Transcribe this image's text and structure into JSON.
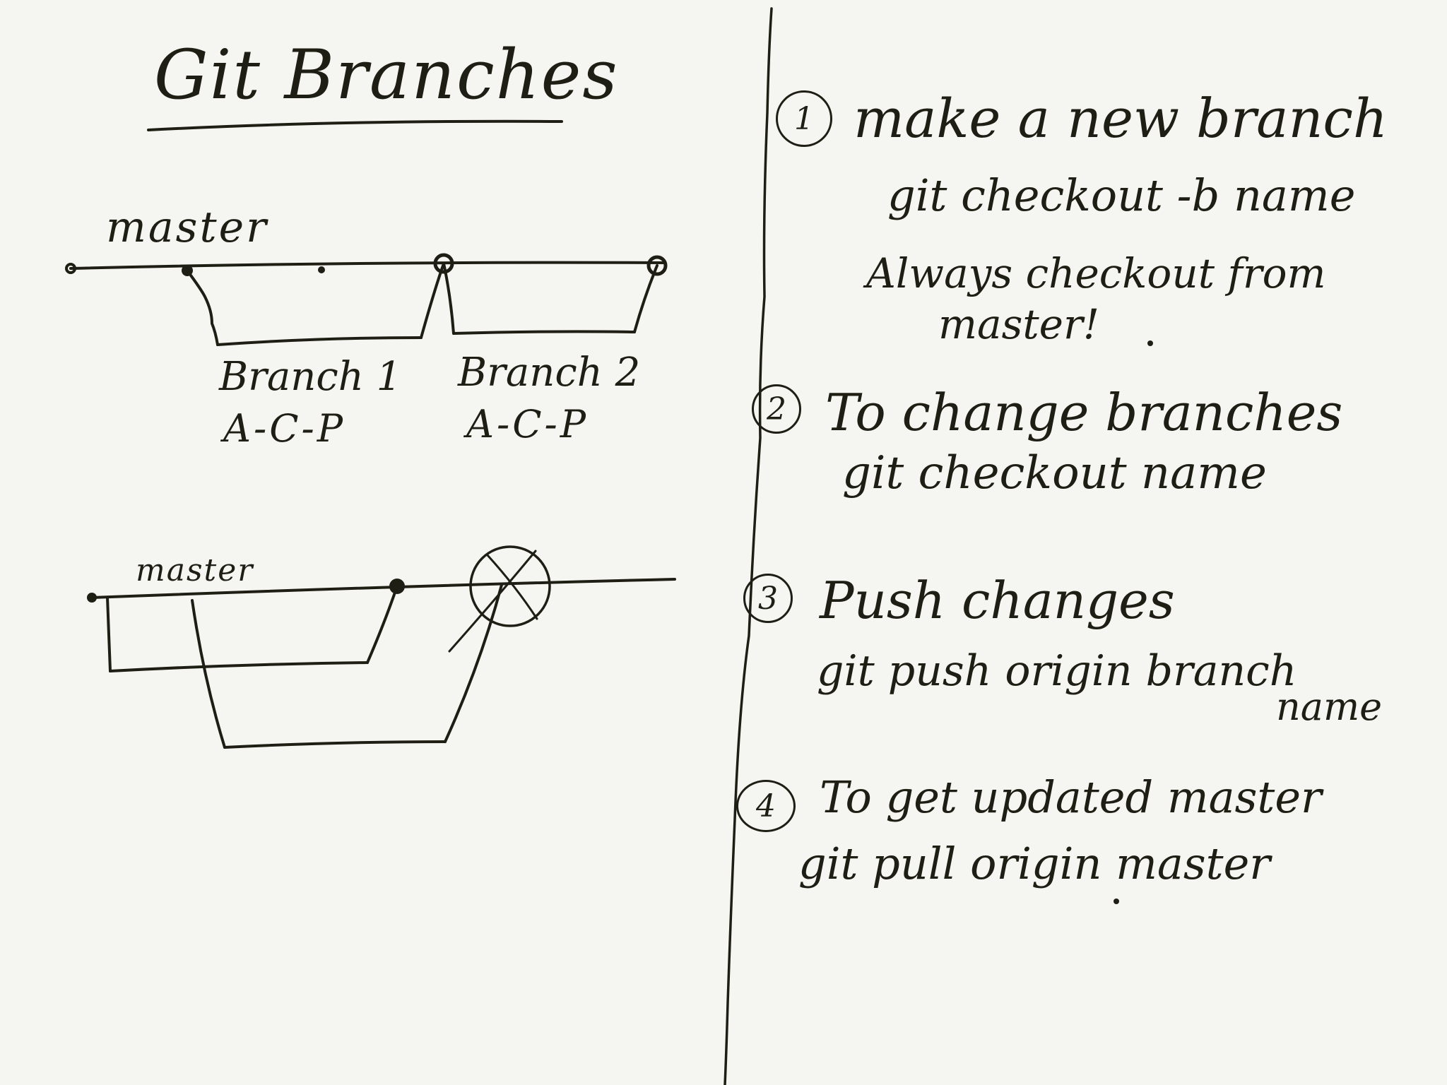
{
  "title": "Git Branches",
  "diagram": {
    "top": {
      "trunk_label": "master",
      "branch1_label": "Branch 1",
      "branch1_steps": "A-C-P",
      "branch2_label": "Branch 2",
      "branch2_steps": "A-C-P"
    },
    "bottom": {
      "trunk_label": "master"
    }
  },
  "steps": [
    {
      "number": "1",
      "heading": "make a new branch",
      "command": "git checkout -b name",
      "note_line1": "Always checkout from",
      "note_line2": "master!"
    },
    {
      "number": "2",
      "heading": "To change branches",
      "command": "git checkout name"
    },
    {
      "number": "3",
      "heading": "Push changes",
      "command": "git push origin branch",
      "command_cont": "name"
    },
    {
      "number": "4",
      "heading": "To get updated master",
      "command": "git pull origin master"
    }
  ],
  "colors": {
    "ink": "#1e1e14",
    "paper": "#f5f5f1"
  }
}
